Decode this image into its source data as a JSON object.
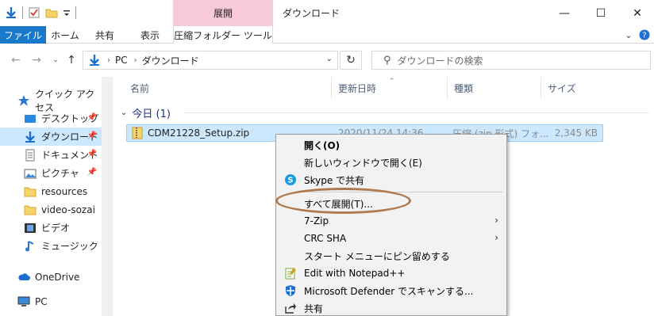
{
  "titlebar": {
    "context_tab_header": "展開",
    "window_title": "ダウンロード",
    "minimize": "—",
    "maximize": "☐",
    "close": "✕"
  },
  "ribbon": {
    "tabs": [
      "ファイル",
      "ホーム",
      "共有",
      "表示",
      "圧縮フォルダー ツール"
    ]
  },
  "address": {
    "path": [
      "PC",
      "ダウンロード"
    ],
    "search_placeholder": "ダウンロードの検索"
  },
  "sidebar": {
    "items": [
      {
        "label": "クイック アクセス",
        "icon": "star-icon"
      },
      {
        "label": "デスクトップ",
        "icon": "desktop-icon",
        "pinned": true
      },
      {
        "label": "ダウンロード",
        "icon": "download-icon",
        "pinned": true,
        "selected": true
      },
      {
        "label": "ドキュメント",
        "icon": "document-icon",
        "pinned": true
      },
      {
        "label": "ピクチャ",
        "icon": "picture-icon",
        "pinned": true
      },
      {
        "label": "resources",
        "icon": "folder-icon"
      },
      {
        "label": "video-sozai",
        "icon": "folder-icon"
      },
      {
        "label": "ビデオ",
        "icon": "video-icon"
      },
      {
        "label": "ミュージック",
        "icon": "music-icon"
      },
      {
        "label": "OneDrive",
        "icon": "cloud-icon"
      },
      {
        "label": "PC",
        "icon": "pc-icon"
      }
    ]
  },
  "columns": {
    "name": "名前",
    "modified": "更新日時",
    "type": "種類",
    "size": "サイズ"
  },
  "group": {
    "label": "今日 (1)"
  },
  "file": {
    "name": "CDM21228_Setup.zip",
    "modified": "2020/11/24 14:36",
    "type": "圧縮 (zip 形式) フォ...",
    "size": "2,345 KB"
  },
  "context_menu": {
    "items": [
      {
        "label": "開く(O)",
        "bold": true
      },
      {
        "label": "新しいウィンドウで開く(E)"
      },
      {
        "label": "Skype で共有",
        "icon": "skype-icon"
      },
      {
        "label": "すべて展開(T)..."
      },
      {
        "label": "7-Zip",
        "submenu": true
      },
      {
        "label": "CRC SHA",
        "submenu": true
      },
      {
        "label": "スタート メニューにピン留めする"
      },
      {
        "label": "Edit with Notepad++",
        "icon": "notepadpp-icon"
      },
      {
        "label": "Microsoft Defender でスキャンする...",
        "icon": "defender-icon"
      },
      {
        "label": "共有",
        "icon": "share-icon"
      }
    ]
  },
  "colors": {
    "accent": "#1979ca",
    "selection": "#cce8ff",
    "context_tab": "#f7c9d9",
    "annotation_oval": "#b07a4e"
  }
}
